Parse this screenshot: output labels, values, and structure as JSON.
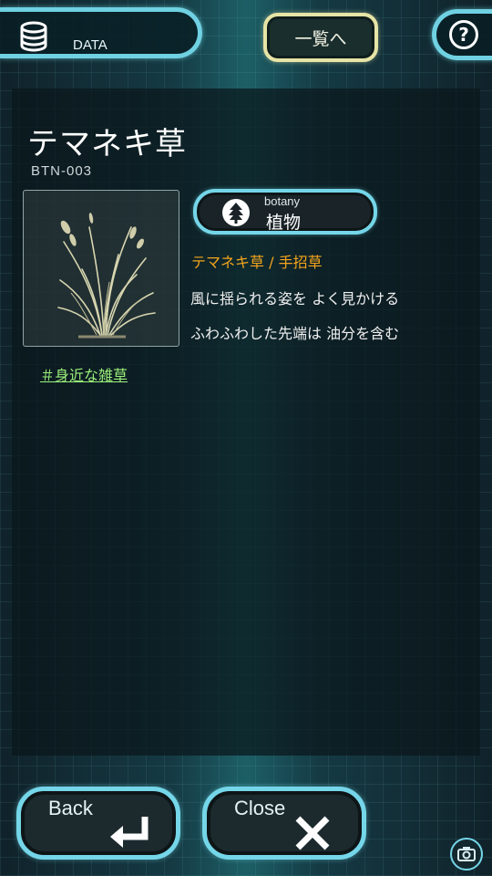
{
  "topbar": {
    "data_label": "DATA",
    "list_label": "一覧へ",
    "help_icon": "question-icon",
    "data_icon": "database-icon"
  },
  "entry": {
    "title": "テマネキ草",
    "code": "BTN-003",
    "tag": "＃身近な雑草",
    "category_en": "botany",
    "category_jp": "植物",
    "category_icon": "tree-icon",
    "names": "テマネキ草 / 手招草",
    "description": [
      "風に揺られる姿を よく見かける",
      "ふわふわした先端は 油分を含む"
    ]
  },
  "buttons": {
    "back_label": "Back",
    "close_label": "Close",
    "back_icon": "return-arrow-icon",
    "close_icon": "x-icon",
    "camera_icon": "camera-icon"
  },
  "colors": {
    "accent_cyan": "#74d6e8",
    "list_button_border": "#e6e4a6",
    "names_orange": "#f4a41c",
    "tag_green": "#9cf07a"
  }
}
